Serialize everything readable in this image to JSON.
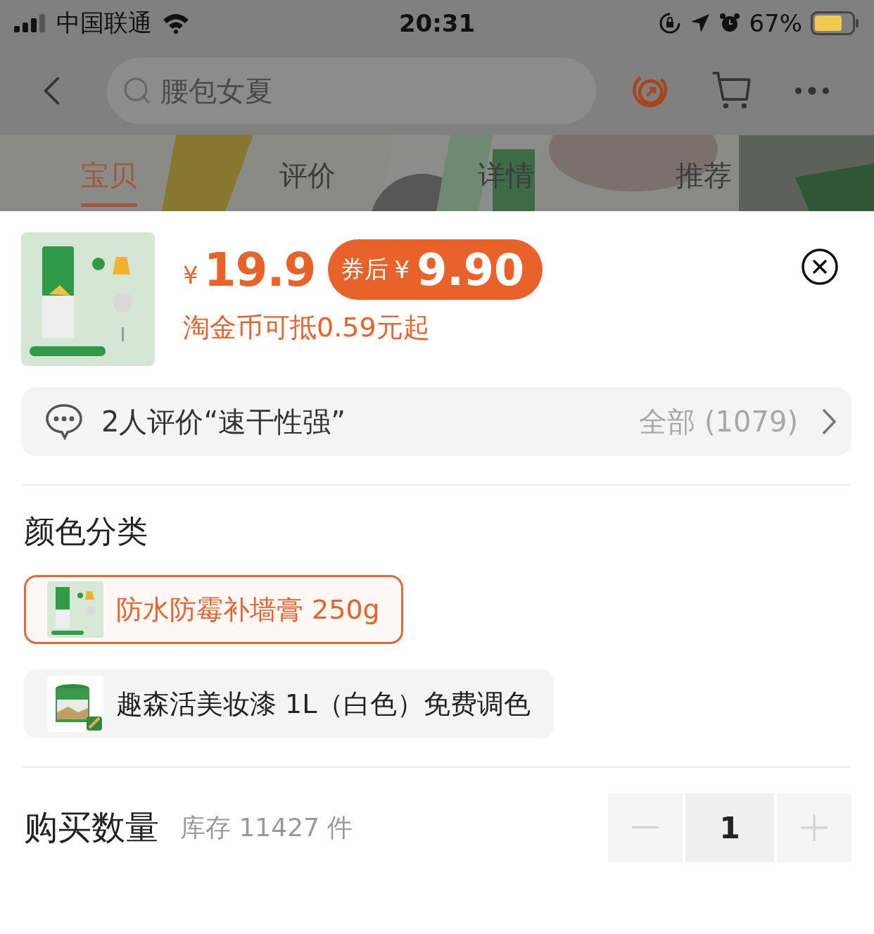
{
  "status_bar": {
    "carrier": "中国联通",
    "time": "20:31",
    "battery": "67%"
  },
  "search": {
    "placeholder": "腰包女夏"
  },
  "tabs": [
    {
      "label": "宝贝",
      "selected": true
    },
    {
      "label": "评价",
      "selected": false
    },
    {
      "label": "详情",
      "selected": false
    },
    {
      "label": "推荐",
      "selected": false
    }
  ],
  "product": {
    "price_symbol": "¥",
    "price": "19.9",
    "coupon_label": "券后",
    "coupon_symbol": "¥",
    "coupon_price": "9.90",
    "coin_note": "淘金币可抵0.59元起"
  },
  "reviews": {
    "summary": "2人评价“速干性强”",
    "all": "全部 (1079)"
  },
  "options_title": "颜色分类",
  "options": [
    {
      "label": "防水防霉补墙膏 250g",
      "selected": true,
      "kind": "tube"
    },
    {
      "label": "趣森活美妆漆 1L（白色）免费调色",
      "selected": false,
      "kind": "can"
    }
  ],
  "quantity": {
    "label": "购买数量",
    "stock": "库存 11427 件",
    "value": "1"
  }
}
